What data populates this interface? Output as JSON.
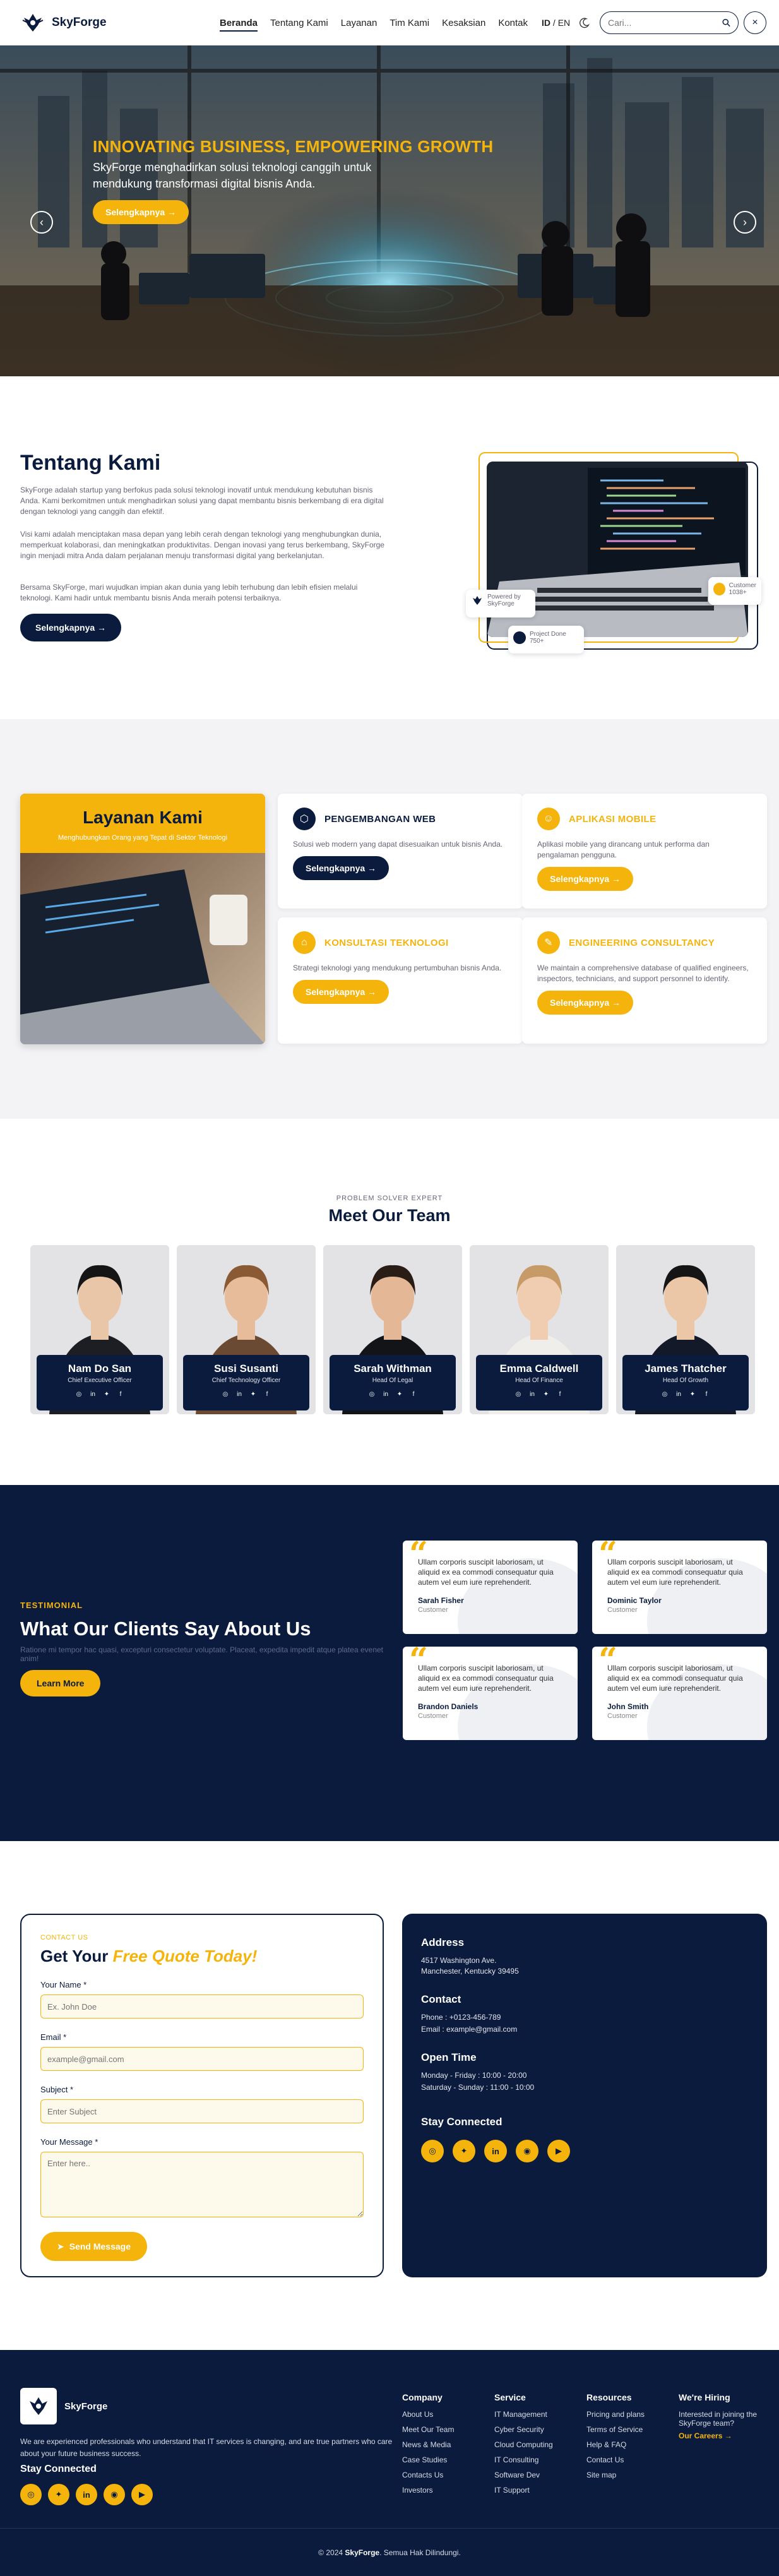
{
  "header": {
    "brand": "SkyForge",
    "nav": [
      "Beranda",
      "Tentang Kami",
      "Layanan",
      "Tim Kami",
      "Kesaksian",
      "Kontak"
    ],
    "lang_id": "ID",
    "lang_sep": " / ",
    "lang_en": "EN",
    "search_placeholder": "Cari...",
    "close_glyph": "×"
  },
  "hero": {
    "title": "INNOVATING BUSINESS, EMPOWERING GROWTH",
    "subtitle": "SkyForge menghadirkan solusi teknologi canggih untuk mendukung transformasi digital bisnis Anda.",
    "button": "Selengkapnya →",
    "prev": "‹",
    "next": "›"
  },
  "about": {
    "title": "Tentang Kami",
    "p1": "SkyForge adalah startup yang berfokus pada solusi teknologi inovatif untuk mendukung kebutuhan bisnis Anda. Kami berkomitmen untuk menghadirkan solusi yang dapat membantu bisnis berkembang di era digital dengan teknologi yang canggih dan efektif.",
    "p2": "Visi kami adalah menciptakan masa depan yang lebih cerah dengan teknologi yang menghubungkan dunia, memperkuat kolaborasi, dan meningkatkan produktivitas. Dengan inovasi yang terus berkembang, SkyForge ingin menjadi mitra Anda dalam perjalanan menuju transformasi digital yang berkelanjutan.",
    "p3": "Bersama SkyForge, mari wujudkan impian akan dunia yang lebih terhubung dan lebih efisien melalui teknologi. Kami hadir untuk membantu bisnis Anda meraih potensi terbaiknya.",
    "button": "Selengkapnya →",
    "badge_powered": "Powered by",
    "badge_powered_name": "SkyForge",
    "badge_customer": "Customer",
    "badge_customer_val": "1038+",
    "badge_exp": "Project Done",
    "badge_exp_val": "750+"
  },
  "services": {
    "title": "Layanan Kami",
    "subtitle": "Menghubungkan Orang yang Tepat di Sektor Teknologi",
    "items": [
      {
        "title": "PENGEMBANGAN WEB",
        "desc": "Solusi web modern yang dapat disesuaikan untuk bisnis Anda.",
        "button": "Selengkapnya →"
      },
      {
        "title": "APLIKASI MOBILE",
        "desc": "Aplikasi mobile yang dirancang untuk performa dan pengalaman pengguna.",
        "button": "Selengkapnya →"
      },
      {
        "title": "KONSULTASI TEKNOLOGI",
        "desc": "Strategi teknologi yang mendukung pertumbuhan bisnis Anda.",
        "button": "Selengkapnya →"
      },
      {
        "title": "ENGINEERING CONSULTANCY",
        "desc": "We maintain a comprehensive database of qualified engineers, inspectors, technicians, and support personnel to identify.",
        "button": "Selengkapnya →"
      }
    ]
  },
  "team": {
    "kicker": "PROBLEM SOLVER EXPERT",
    "title": "Meet Our Team",
    "members": [
      {
        "name": "Nam Do San",
        "role": "Chief Executive Officer"
      },
      {
        "name": "Susi Susanti",
        "role": "Chief Technology Officer"
      },
      {
        "name": "Sarah Withman",
        "role": "Head Of Legal"
      },
      {
        "name": "Emma Caldwell",
        "role": "Head Of Finance"
      },
      {
        "name": "James Thatcher",
        "role": "Head Of Growth"
      }
    ]
  },
  "testimonials": {
    "kicker": "TESTIMONIAL",
    "title": "What Our Clients Say About Us",
    "subtitle": "Ratione mi tempor hac quasi, excepturi consectetur voluptate. Placeat, expedita impedit atque platea evenet anim!",
    "button": "Learn More",
    "quote_mark": "“",
    "items": [
      {
        "text": "Ullam corporis suscipit laboriosam, ut aliquid ex ea commodi consequatur quia autem vel eum iure reprehenderit.",
        "name": "Sarah Fisher",
        "role": "Customer"
      },
      {
        "text": "Ullam corporis suscipit laboriosam, ut aliquid ex ea commodi consequatur quia autem vel eum iure reprehenderit.",
        "name": "Dominic Taylor",
        "role": "Customer"
      },
      {
        "text": "Ullam corporis suscipit laboriosam, ut aliquid ex ea commodi consequatur quia autem vel eum iure reprehenderit.",
        "name": "Brandon Daniels",
        "role": "Customer"
      },
      {
        "text": "Ullam corporis suscipit laboriosam, ut aliquid ex ea commodi consequatur quia autem vel eum iure reprehenderit.",
        "name": "John Smith",
        "role": "Customer"
      }
    ]
  },
  "contact": {
    "kicker": "CONTACT US",
    "title_pre": "Get Your ",
    "title_em": "Free Quote Today!",
    "name_label": "Your Name *",
    "name_ph": "Ex. John Doe",
    "email_label": "Email *",
    "email_ph": "example@gmail.com",
    "subject_label": "Subject *",
    "subject_ph": "Enter Subject",
    "message_label": "Your Message *",
    "message_ph": "Enter here..",
    "send": "Send Message",
    "address_h": "Address",
    "address": "4517 Washington Ave.\nManchester, Kentucky 39495",
    "contact_h": "Contact",
    "phone": "Phone : +0123-456-789",
    "email": "Email : example@gmail.com",
    "open_h": "Open Time",
    "open1": "Monday - Friday : 10:00 - 20:00",
    "open2": "Saturday - Sunday : 11:00 - 10:00",
    "stay_h": "Stay Connected"
  },
  "footer": {
    "brand": "SkyForge",
    "desc": "We are experienced professionals who understand that IT services is changing, and are true partners who care about your future business success.",
    "stay": "Stay Connected",
    "company_h": "Company",
    "company": [
      "About Us",
      "Meet Our Team",
      "News & Media",
      "Case Studies",
      "Contacts Us",
      "Investors"
    ],
    "service_h": "Service",
    "service": [
      "IT Management",
      "Cyber Security",
      "Cloud Computing",
      "IT Consulting",
      "Software Dev",
      "IT Support"
    ],
    "resources_h": "Resources",
    "resources": [
      "Pricing and plans",
      "Terms of Service",
      "Help & FAQ",
      "Contact Us",
      "Site map"
    ],
    "hiring_h": "We're Hiring",
    "hiring": "Interested in joining the SkyForge team?",
    "careers": "Our Careers →",
    "copy_pre": "© 2024 ",
    "copy_brand": "SkyForge",
    "copy_post": ". Semua Hak Dilindungi."
  },
  "colors": {
    "navy": "#0a1b3d",
    "accent": "#f4b40c"
  }
}
